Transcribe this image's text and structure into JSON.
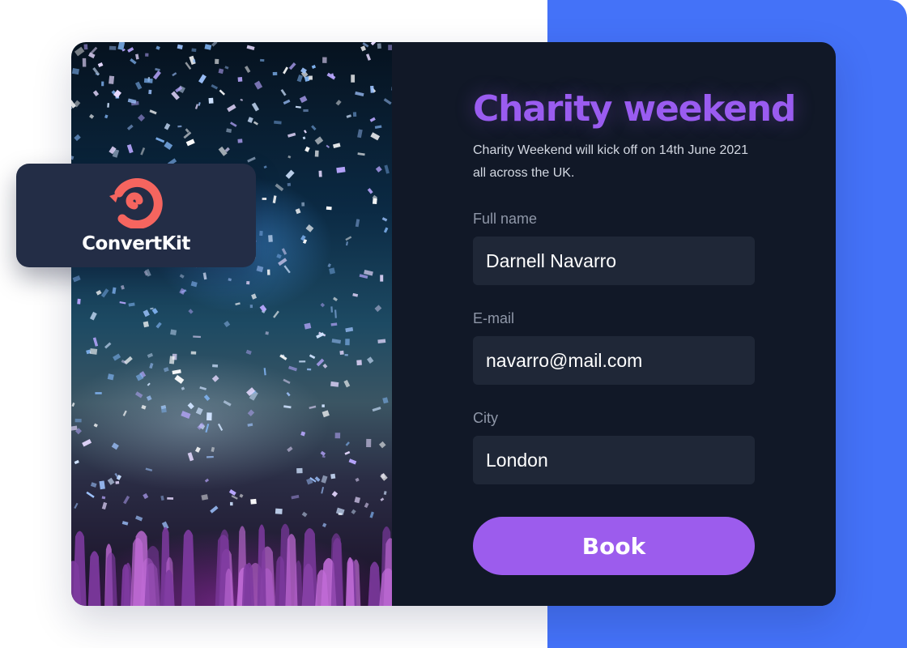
{
  "brand": {
    "name": "ConvertKit",
    "logo_icon": "convertkit-logo-icon",
    "logo_color": "#f5655f"
  },
  "hero_image": {
    "subject": "concert-confetti-photo"
  },
  "form": {
    "title": "Charity weekend",
    "description": "Charity Weekend will kick off on 14th June 2021 all across the UK.",
    "fields": [
      {
        "label": "Full name",
        "value": "Darnell Navarro"
      },
      {
        "label": "E-mail",
        "value": "navarro@mail.com"
      },
      {
        "label": "City",
        "value": "London"
      }
    ],
    "submit_label": "Book"
  },
  "colors": {
    "accent": "#9c5ced",
    "background_panel": "#4472f8",
    "form_background": "#111827",
    "field_background": "#1f2737"
  }
}
